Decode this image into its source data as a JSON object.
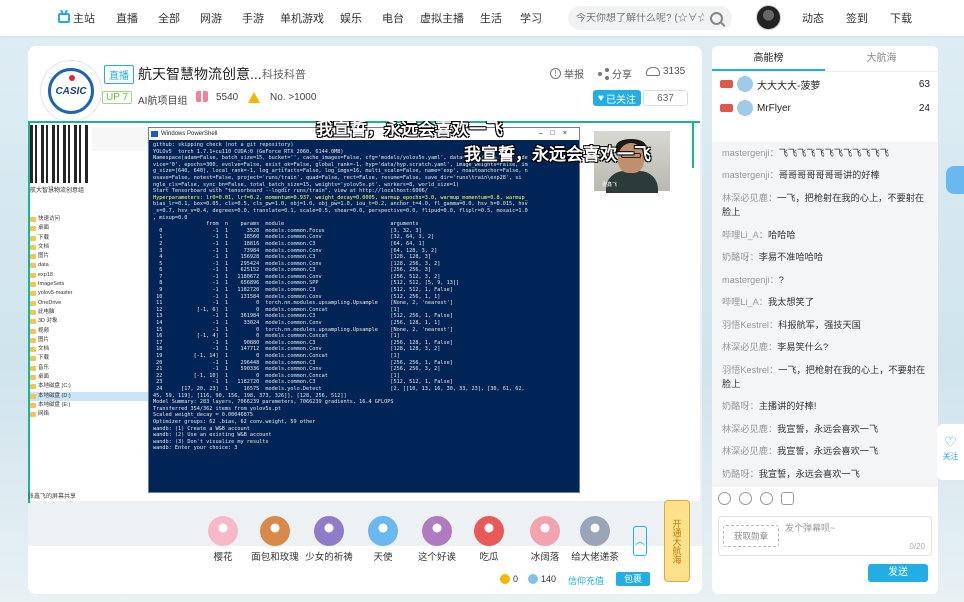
{
  "nav": {
    "home": "主站",
    "live": "直播",
    "all": "全部",
    "online_games": "网游",
    "mobile_games": "手游",
    "single_games": "单机游戏",
    "entertainment": "娱乐",
    "radio": "电台",
    "vtuber": "虚拟主播",
    "life": "生活",
    "study": "学习",
    "search_placeholder": "今天你想了解什么呢? (☆∀☆)",
    "dynamic": "动态",
    "checkin": "签到",
    "download": "下载"
  },
  "room": {
    "logo_text": "CASIC",
    "live_badge": "直播",
    "title": "航天智慧物流创意...",
    "category": "科技科普",
    "up_level": "UP 7",
    "area_rank": "AI航项目组",
    "gift_count": "5540",
    "rank": "No. >1000",
    "report": "举报",
    "share": "分享",
    "viewers": "3135",
    "follow_label": "已关注",
    "follow_count": "637"
  },
  "video": {
    "qr_caption": "航大智慧物流创意组",
    "ps_title": "Windows PowerShell",
    "ps_lines": [
      "github: skipping check (not a git repository)",
      "YOLOv5  torch 1.7.1+cu110 CUDA:0 (GeForce RTX 2060, 6144.0MB)",
      "",
      "Namespace(adam=False, batch_size=15, bucket='', cache_images=False, cfg='models/yolov5s.yaml', data='data/coco.yaml', de",
      "vice='0', epochs=300, evolve=False, exist_ok=False, global_rank=-1, hyp='data/hyp.scratch.yaml', image_weights=False, im",
      "g_size=[640, 640], local_rank=-1, log_artifacts=False, log_imgs=16, multi_scale=False, name='exp', noautoanchor=False, n",
      "osave=False, notest=False, project='runs/train', quad=False, rect=False, resume=False, save_dir='runs\\train\\exp28', si",
      "ngle_cls=False, sync_bn=False, total_batch_size=15, weights='yolov5s.pt', workers=8, world_size=1)",
      "Start Tensorboard with \"tensorboard --logdir runs/train\", view at http://localhost:6006/",
      "Hyperparameters: lr0=0.01, lrf=0.2, momentum=0.937, weight_decay=0.0005, warmup_epochs=3.0, warmup_momentum=0.8, warmup_",
      "bias_lr=0.1, box=0.05, cls=0.5, cls_pw=1.0, obj=1.0, obj_pw=1.0, iou_t=0.2, anchor_t=4.0, fl_gamma=0.0, hsv_h=0.015, hsv",
      "_s=0.7, hsv_v=0.4, degrees=0.0, translate=0.1, scale=0.5, shear=0.0, perspective=0.0, flipud=0.0, fliplr=0.5, mosaic=1.0",
      ", mixup=0.0",
      "",
      "                 from  n    params  module                                  arguments",
      "  0                -1  1      3520  models.common.Focus                     [3, 32, 3]",
      "  1                -1  1     18560  models.common.Conv                      [32, 64, 3, 2]",
      "  2                -1  1     18816  models.common.C3                        [64, 64, 1]",
      "  3                -1  1     73984  models.common.Conv                      [64, 128, 3, 2]",
      "  4                -1  1    156928  models.common.C3                        [128, 128, 3]",
      "  5                -1  1    295424  models.common.Conv                      [128, 256, 3, 2]",
      "  6                -1  1    625152  models.common.C3                        [256, 256, 3]",
      "  7                -1  1   1180672  models.common.Conv                      [256, 512, 3, 2]",
      "  8                -1  1    656896  models.common.SPP                       [512, 512, [5, 9, 13]]",
      "  9                -1  1   1182720  models.common.C3                        [512, 512, 1, False]",
      " 10                -1  1    131584  models.common.Conv                      [512, 256, 1, 1]",
      " 11                -1  1         0  torch.nn.modules.upsampling.Upsample    [None, 2, 'nearest']",
      " 12           [-1, 6]  1         0  models.common.Concat                    [1]",
      " 13                -1  1    361984  models.common.C3                        [512, 256, 1, False]",
      " 14                -1  1     33024  models.common.Conv                      [256, 128, 1, 1]",
      " 15                -1  1         0  torch.nn.modules.upsampling.Upsample    [None, 2, 'nearest']",
      " 16           [-1, 4]  1         0  models.common.Concat                    [1]",
      " 17                -1  1     90880  models.common.C3                        [256, 128, 1, False]",
      " 18                -1  1    147712  models.common.Conv                      [128, 128, 3, 2]",
      " 19          [-1, 14]  1         0  models.common.Concat                    [1]",
      " 20                -1  1    296448  models.common.C3                        [256, 256, 1, False]",
      " 21                -1  1    590336  models.common.Conv                      [256, 256, 3, 2]",
      " 22          [-1, 10]  1         0  models.common.Concat                    [1]",
      " 23                -1  1   1182720  models.common.C3                        [512, 512, 1, False]",
      " 24      [17, 20, 23]  1     16575  models.yolo.Detect                      [2, [[10, 13, 16, 30, 33, 23], [30, 61, 62,",
      "45, 59, 119], [116, 90, 156, 198, 373, 326]], [128, 256, 512]]",
      "Model Summary: 283 layers, 7066239 parameters, 7066239 gradients, 16.4 GFLOPS",
      "",
      "Transferred 354/362 items from yolov5s.pt",
      "Scaled weight_decay = 0.00046875",
      "Optimizer groups: 62 .bias, 62 conv.weight, 59 other",
      "wandb: (1) Create a W&B account",
      "wandb: (2) Use an existing W&B account",
      "wandb: (3) Don't visualize my results",
      "wandb: Enter your choice: 3"
    ],
    "tree_items": [
      "快速访问",
      "桌面",
      "下载",
      "文档",
      "图片",
      "data",
      "exp18",
      "ImageSets",
      "yolov5-master",
      "OneDrive",
      "此电脑",
      "3D 对象",
      "视频",
      "图片",
      "文档",
      "下载",
      "音乐",
      "桌面",
      "本地磁盘 (C:)",
      "本地磁盘 (D:)",
      "本地磁盘 (E:)",
      "网络"
    ],
    "cam_caption": "张鑫飞",
    "danmaku_1": "我宣誓，永远会喜欢一飞",
    "danmaku_2": "我宣誓，永远会喜欢一飞",
    "status_bar": "张鑫飞的屏幕共享"
  },
  "gifts": [
    {
      "name": "樱花",
      "color": "#f7b9c8"
    },
    {
      "name": "面包和玫瑰",
      "color": "#d98a4a"
    },
    {
      "name": "少女的祈祷",
      "color": "#8f7bc8"
    },
    {
      "name": "天使",
      "color": "#6ab8f0"
    },
    {
      "name": "这个好诶",
      "color": "#b07ac0"
    },
    {
      "name": "吃瓜",
      "color": "#e85a5a"
    },
    {
      "name": "冰阔落",
      "color": "#f3a3b0"
    },
    {
      "name": "给大佬递茶",
      "color": "#9aa5b8"
    }
  ],
  "promo": "开通大航海",
  "wallet": {
    "gold": "0",
    "silver": "140",
    "recharge": "信仰充值",
    "pack": "包裹"
  },
  "side": {
    "tab_rank": "高能榜",
    "tab_guard": "大航海",
    "ranks": [
      {
        "name": "大大大大-菠萝",
        "score": "63"
      },
      {
        "name": "MrFlyer",
        "score": "24"
      }
    ],
    "messages": [
      {
        "user": "mastergenji",
        "text": "飞飞飞飞飞飞飞飞飞飞飞飞"
      },
      {
        "user": "mastergenji",
        "text": "哥哥哥哥哥哥哥讲的好棒"
      },
      {
        "user": "林深必见鹿",
        "text": "一飞，把枪射在我的心上，不要射在脸上"
      },
      {
        "user": "哔哩Li_A",
        "text": "哈哈哈"
      },
      {
        "user": "奶酪呀",
        "text": "李易不准哈哈哈"
      },
      {
        "user": "mastergenji",
        "text": "?"
      },
      {
        "user": "哔哩Li_A",
        "text": "我太想笑了"
      },
      {
        "user": "羽悟Kestrel",
        "text": "科报航军，强技天国"
      },
      {
        "user": "林深必见鹿",
        "text": "李易笑什么?"
      },
      {
        "user": "羽悟Kestrel",
        "text": "一飞，把枪射在我的心上，不要射在脸上"
      },
      {
        "user": "奶酪呀",
        "text": "主播讲的好棒!"
      },
      {
        "user": "林深必见鹿",
        "text": "我宣誓，永远会喜欢一飞"
      },
      {
        "user": "林深必见鹿",
        "text": "我宣誓，永远会喜欢一飞"
      },
      {
        "user": "奶酪呀",
        "text": "我宣誓，永远会喜欢一飞"
      }
    ],
    "fan_medal": "获取勋章",
    "input_placeholder": "发个弹幕呗~",
    "char_count": "0/20",
    "send": "发送"
  },
  "float_follow": "关注"
}
